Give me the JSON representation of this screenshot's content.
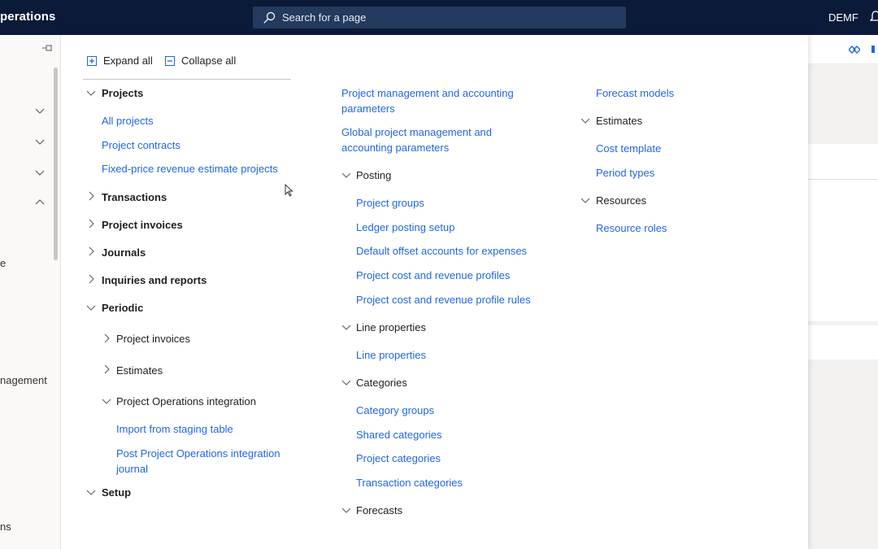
{
  "app": {
    "title": "perations",
    "search_placeholder": "Search for a page",
    "company": "DEMF"
  },
  "left_nav": {
    "fragments": [
      "e",
      "nagement",
      "ns"
    ]
  },
  "toolbar": {
    "expand_all": "Expand all",
    "collapse_all": "Collapse all"
  },
  "col1": {
    "projects": "Projects",
    "all_projects": "All projects",
    "project_contracts": "Project contracts",
    "fixed_price": "Fixed-price revenue estimate projects",
    "transactions": "Transactions",
    "project_invoices": "Project invoices",
    "journals": "Journals",
    "inquiries": "Inquiries and reports",
    "periodic": "Periodic",
    "periodic_project_invoices": "Project invoices",
    "periodic_estimates": "Estimates",
    "po_integration": "Project Operations integration",
    "import_staging": "Import from staging table",
    "post_po_line1": "Post Project Operations integration",
    "post_po_line2": "journal",
    "setup": "Setup"
  },
  "col2": {
    "pma_params_line1": "Project management and accounting",
    "pma_params_line2": "parameters",
    "global_params_line1": "Global project management and",
    "global_params_line2": "accounting parameters",
    "posting": "Posting",
    "project_groups": "Project groups",
    "ledger_posting_setup": "Ledger posting setup",
    "default_offset": "Default offset accounts for expenses",
    "cost_revenue_profiles": "Project cost and revenue profiles",
    "cost_revenue_profile_rules": "Project cost and revenue profile rules",
    "line_properties_group": "Line properties",
    "line_properties": "Line properties",
    "categories": "Categories",
    "category_groups": "Category groups",
    "shared_categories": "Shared categories",
    "project_categories": "Project categories",
    "transaction_categories": "Transaction categories",
    "forecasts": "Forecasts"
  },
  "col3": {
    "forecast_models": "Forecast models",
    "estimates": "Estimates",
    "cost_template": "Cost template",
    "period_types": "Period types",
    "resources": "Resources",
    "resource_roles": "Resource roles"
  },
  "colors": {
    "topbar": "#0b1a38",
    "link": "#2266e3",
    "search_bg": "#243a5e"
  }
}
